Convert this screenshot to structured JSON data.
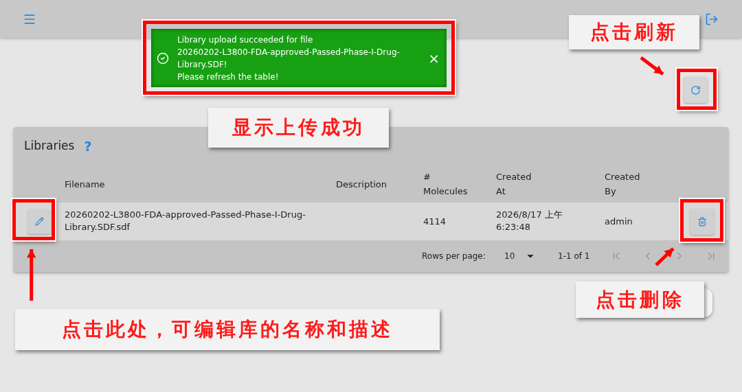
{
  "toast": {
    "lines": [
      "Library upload succeeded for file",
      "20260202-L3800-FDA-approved-Passed-Phase-I-Drug-",
      "Library.SDF!",
      "Please refresh the table!"
    ],
    "close": "×"
  },
  "libraries": {
    "title": "Libraries",
    "help": "?",
    "columns": [
      "Filename",
      "Description",
      "# Molecules",
      "Created At",
      "Created By"
    ],
    "rows": [
      {
        "filename": "20260202-L3800-FDA-approved-Passed-Phase-I-Drug-Library.SDF.sdf",
        "description": "",
        "molecules": "4114",
        "created_at": "2026/8/17 上午 6:23:48",
        "created_by": "admin"
      }
    ],
    "pagination": {
      "rows_label": "Rows per page:",
      "rows_value": "10",
      "range": "1-1 of 1"
    }
  },
  "annotations": [
    {
      "kind": "refresh",
      "text": "点击刷新"
    },
    {
      "kind": "toast",
      "text": "显示上传成功"
    },
    {
      "kind": "edit",
      "text": "点击此处，可编辑库的名称和描述"
    },
    {
      "kind": "delete",
      "text": "点击删除"
    }
  ]
}
